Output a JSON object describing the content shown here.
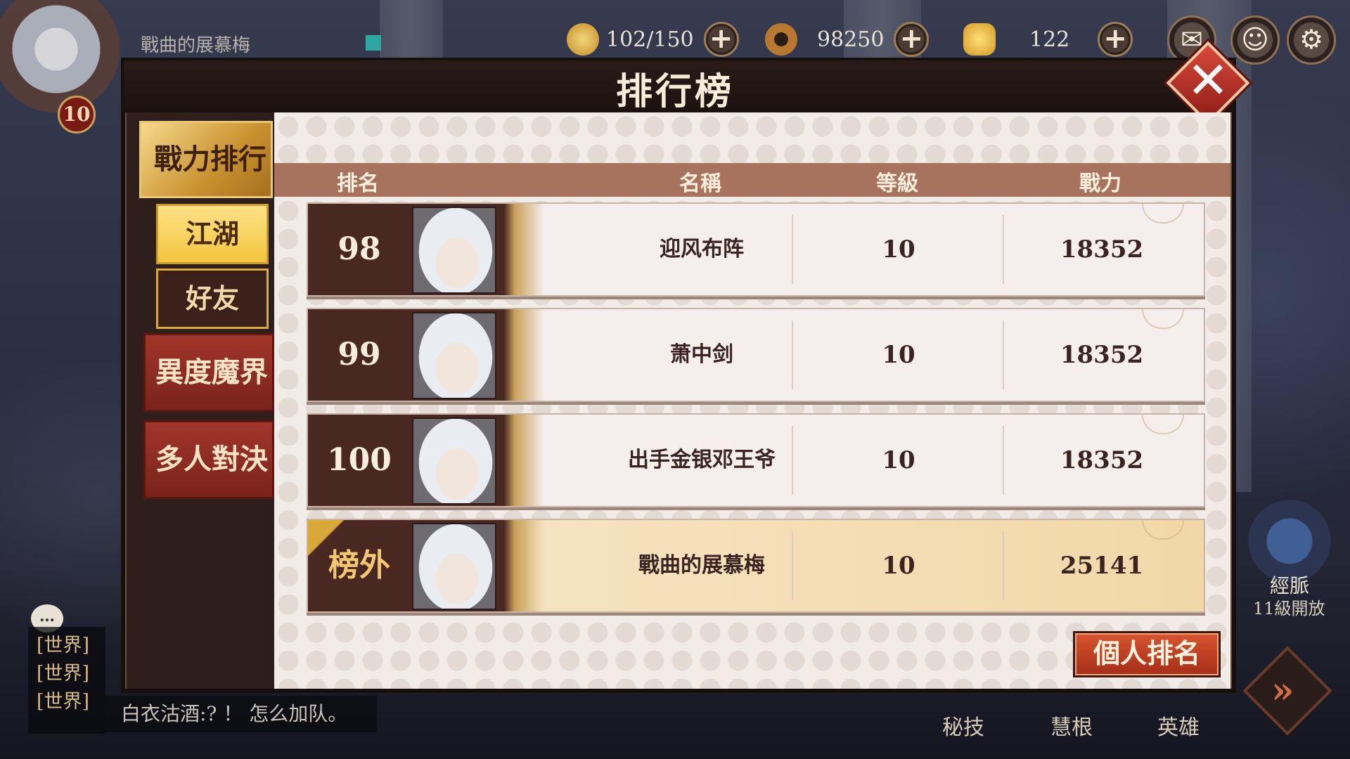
{
  "hud": {
    "player_name": "戰曲的展慕梅",
    "player_level": "10",
    "stamina": "102/150",
    "coins": "98250",
    "gold": "122",
    "plus": "+"
  },
  "panel": {
    "title": "排行榜",
    "close": "✕"
  },
  "sidebar": {
    "main_tab": "戰力排行",
    "sub_tabs": [
      "江湖",
      "好友"
    ],
    "other_tabs": [
      "異度魔界",
      "多人對決"
    ]
  },
  "table": {
    "headers": [
      "排名",
      "名稱",
      "等級",
      "戰力"
    ],
    "rows": [
      {
        "rank": "98",
        "name": "迎风布阵",
        "level": "10",
        "power": "18352"
      },
      {
        "rank": "99",
        "name": "萧中剑",
        "level": "10",
        "power": "18352"
      },
      {
        "rank": "100",
        "name": "出手金银邓王爷",
        "level": "10",
        "power": "18352"
      },
      {
        "rank": "榜外",
        "name": "戰曲的展慕梅",
        "level": "10",
        "power": "25141"
      }
    ]
  },
  "footer": {
    "personal_rank_button": "個人排名"
  },
  "chat": {
    "tags": [
      "[世界]",
      "[世界]",
      "[世界]"
    ],
    "last_message": "白衣沽酒:? ！ 怎么加队。"
  },
  "right": {
    "meridian_label": "經脈",
    "meridian_unlock": "11級開放",
    "bottom_tabs": [
      "秘技",
      "慧根",
      "英雄"
    ]
  },
  "colors": {
    "accent_gold": "#d9a83a",
    "row_dark": "#4a2822",
    "button_red": "#c5431f"
  }
}
